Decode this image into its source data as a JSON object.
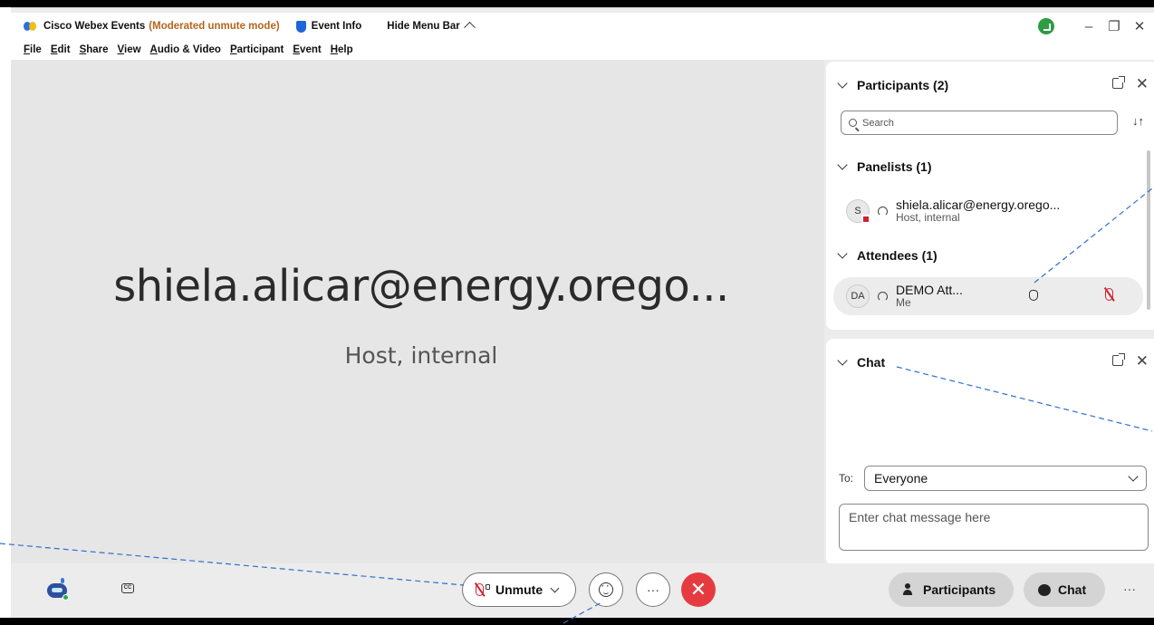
{
  "window": {
    "app_name": "Cisco Webex Events",
    "mode": "(Moderated unmute mode)",
    "event_info": "Event Info",
    "hide_menu_bar": "Hide Menu Bar",
    "controls": {
      "minimize": "–",
      "restore": "❐",
      "close": "✕"
    }
  },
  "menu": [
    "File",
    "Edit",
    "Share",
    "View",
    "Audio & Video",
    "Participant",
    "Event",
    "Help"
  ],
  "menu_accel": [
    "F",
    "E",
    "S",
    "V",
    "A",
    "P",
    "E",
    "H"
  ],
  "stage": {
    "name": "shiela.alicar@energy.orego...",
    "role": "Host, internal"
  },
  "participants_panel": {
    "title": "Participants (2)",
    "search_placeholder": "Search",
    "sort_icon": "↓↑",
    "panelists_header": "Panelists (1)",
    "panelists": [
      {
        "initials": "S",
        "name": "shiela.alicar@energy.orego...",
        "role": "Host, internal"
      }
    ],
    "attendees_header": "Attendees (1)",
    "attendees": [
      {
        "initials": "DA",
        "name": "DEMO Att...",
        "role": "Me"
      }
    ]
  },
  "chat_panel": {
    "title": "Chat",
    "to_label": "To:",
    "to_value": "Everyone",
    "input_placeholder": "Enter chat message here"
  },
  "controlbar": {
    "cc_text": "CC",
    "unmute_label": "Unmute",
    "more_label": "···",
    "leave_label": "✕",
    "participants_label": "Participants",
    "chat_label": "Chat",
    "overflow_label": "···"
  },
  "colors": {
    "accent_blue": "#2b6fe0",
    "mode_orange": "#b5651d",
    "leave_red": "#e53b40",
    "status_green": "#2e9b45"
  }
}
